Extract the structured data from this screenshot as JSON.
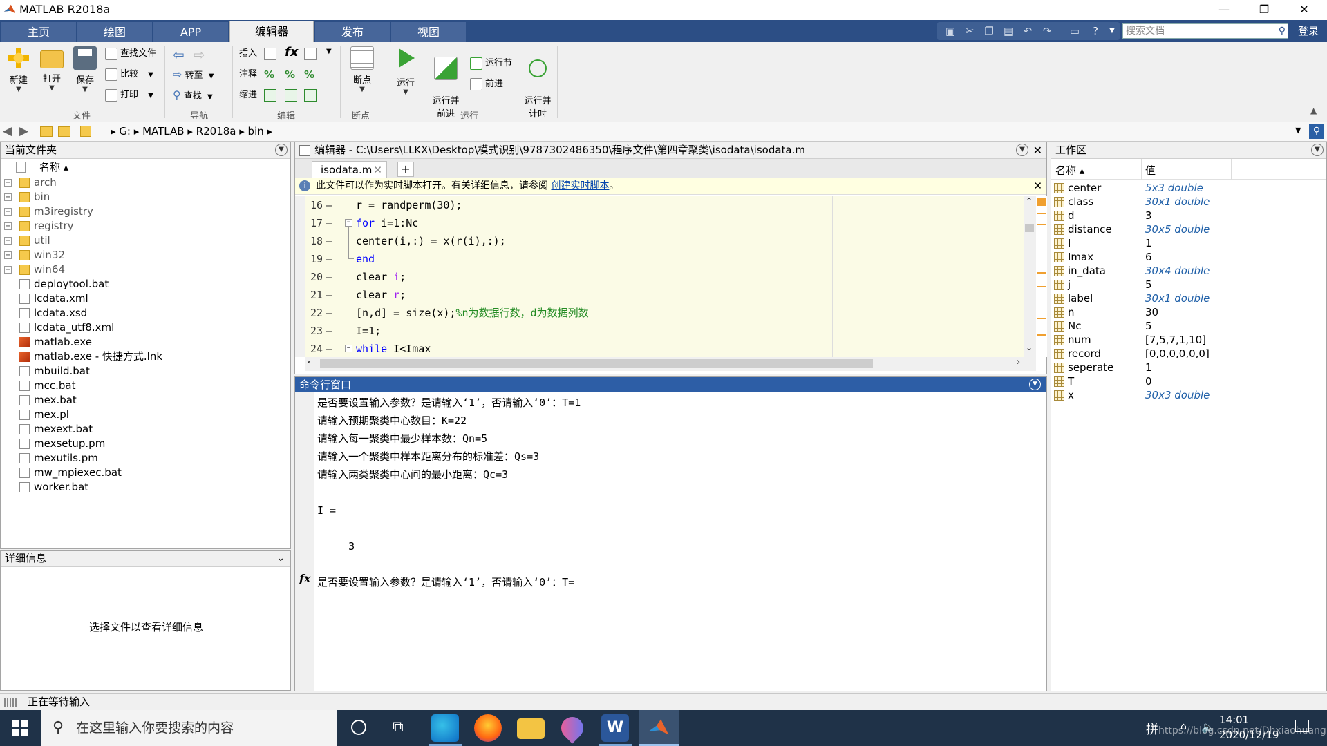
{
  "window": {
    "title": "MATLAB R2018a",
    "min": "—",
    "restore": "❐",
    "close": "✕"
  },
  "ribbon_tabs": [
    "主页",
    "绘图",
    "APP",
    "编辑器",
    "发布",
    "视图"
  ],
  "active_tab": "编辑器",
  "search": {
    "placeholder": "搜索文档",
    "login": "登录"
  },
  "ribbon": {
    "file": {
      "new": "新建",
      "open": "打开",
      "save": "保存",
      "find_files": "查找文件",
      "compare": "比较",
      "print": "打印",
      "group": "文件"
    },
    "nav": {
      "goto": "转至",
      "find": "查找",
      "group": "导航"
    },
    "edit": {
      "insert": "插入",
      "comment": "注释",
      "indent": "缩进",
      "group": "编辑"
    },
    "breakpoints": {
      "label": "断点",
      "group": "断点"
    },
    "run": {
      "run": "运行",
      "run_advance": "运行并\n前进",
      "run_section": "运行节",
      "advance": "前进",
      "run_time": "运行并\n计时",
      "group": "运行"
    }
  },
  "address": {
    "drive": "G:",
    "crumbs": [
      "MATLAB",
      "R2018a",
      "bin"
    ]
  },
  "file_panel": {
    "title": "当前文件夹",
    "col_name": "名称 ▴",
    "folders": [
      "arch",
      "bin",
      "m3iregistry",
      "registry",
      "util",
      "win32",
      "win64"
    ],
    "files": [
      {
        "name": "deploytool.bat",
        "type": "file"
      },
      {
        "name": "lcdata.xml",
        "type": "file"
      },
      {
        "name": "lcdata.xsd",
        "type": "file"
      },
      {
        "name": "lcdata_utf8.xml",
        "type": "file"
      },
      {
        "name": "matlab.exe",
        "type": "matlab"
      },
      {
        "name": "matlab.exe - 快捷方式.lnk",
        "type": "matlab"
      },
      {
        "name": "mbuild.bat",
        "type": "file"
      },
      {
        "name": "mcc.bat",
        "type": "file"
      },
      {
        "name": "mex.bat",
        "type": "file"
      },
      {
        "name": "mex.pl",
        "type": "file"
      },
      {
        "name": "mexext.bat",
        "type": "file"
      },
      {
        "name": "mexsetup.pm",
        "type": "file"
      },
      {
        "name": "mexutils.pm",
        "type": "file"
      },
      {
        "name": "mw_mpiexec.bat",
        "type": "file"
      },
      {
        "name": "worker.bat",
        "type": "file"
      }
    ]
  },
  "detail_panel": {
    "title": "详细信息",
    "message": "选择文件以查看详细信息"
  },
  "editor": {
    "title": "编辑器 - C:\\Users\\LLKX\\Desktop\\模式识别\\9787302486350\\程序文件\\第四章聚类\\isodata\\isodata.m",
    "tab": "isodata.m",
    "info": "此文件可以作为实时脚本打开。有关详细信息，请参阅",
    "info_link": "创建实时脚本",
    "info_end": "。",
    "lines": [
      {
        "num": "16",
        "code": "r = randperm(30);"
      },
      {
        "num": "17",
        "code": "for i=1:Nc"
      },
      {
        "num": "18",
        "code": "center(i,:) = x(r(i),:);"
      },
      {
        "num": "19",
        "code": "end"
      },
      {
        "num": "20",
        "code": "clear i;"
      },
      {
        "num": "21",
        "code": "clear r;"
      },
      {
        "num": "22",
        "code": "[n,d] = size(x);%n为数据行数，d为数据列数"
      },
      {
        "num": "23",
        "code": "I=1;"
      },
      {
        "num": "24",
        "code": "while I<Imax"
      }
    ]
  },
  "command_window": {
    "title": "命令行窗口",
    "lines": [
      "是否要设置输入参数？是请输入‘1’，否请输入‘0’：T=1",
      "请输入预期聚类中心数目：K=22",
      "请输入每一聚类中最少样本数：Qn=5",
      "请输入一个聚类中样本距离分布的标准差：Qs=3",
      "请输入两类聚类中心间的最小距离：Qc=3",
      "",
      "I =",
      "",
      "     3",
      "",
      "是否要设置输入参数？是请输入‘1’，否请输入‘0’：T="
    ],
    "prompt_icon": "fx"
  },
  "workspace": {
    "title": "工作区",
    "col_name": "名称 ▴",
    "col_value": "值",
    "vars": [
      {
        "name": "center",
        "value": "5x3 double",
        "italic": true
      },
      {
        "name": "class",
        "value": "30x1 double",
        "italic": true
      },
      {
        "name": "d",
        "value": "3",
        "italic": false
      },
      {
        "name": "distance",
        "value": "30x5 double",
        "italic": true
      },
      {
        "name": "I",
        "value": "1",
        "italic": false
      },
      {
        "name": "Imax",
        "value": "6",
        "italic": false
      },
      {
        "name": "in_data",
        "value": "30x4 double",
        "italic": true
      },
      {
        "name": "j",
        "value": "5",
        "italic": false
      },
      {
        "name": "label",
        "value": "30x1 double",
        "italic": true
      },
      {
        "name": "n",
        "value": "30",
        "italic": false
      },
      {
        "name": "Nc",
        "value": "5",
        "italic": false
      },
      {
        "name": "num",
        "value": "[7,5,7,1,10]",
        "italic": false
      },
      {
        "name": "record",
        "value": "[0,0,0,0,0,0]",
        "italic": false
      },
      {
        "name": "seperate",
        "value": "1",
        "italic": false
      },
      {
        "name": "T",
        "value": "0",
        "italic": false
      },
      {
        "name": "x",
        "value": "30x3 double",
        "italic": true
      }
    ]
  },
  "status": {
    "text": "正在等待输入"
  },
  "taskbar": {
    "search_placeholder": "在这里输入你要搜索的内容",
    "time": "14:01",
    "date": "2020/12/19",
    "ime": "拼",
    "watermark": "https://blog.csdn.net/Dhxiaohuang"
  }
}
